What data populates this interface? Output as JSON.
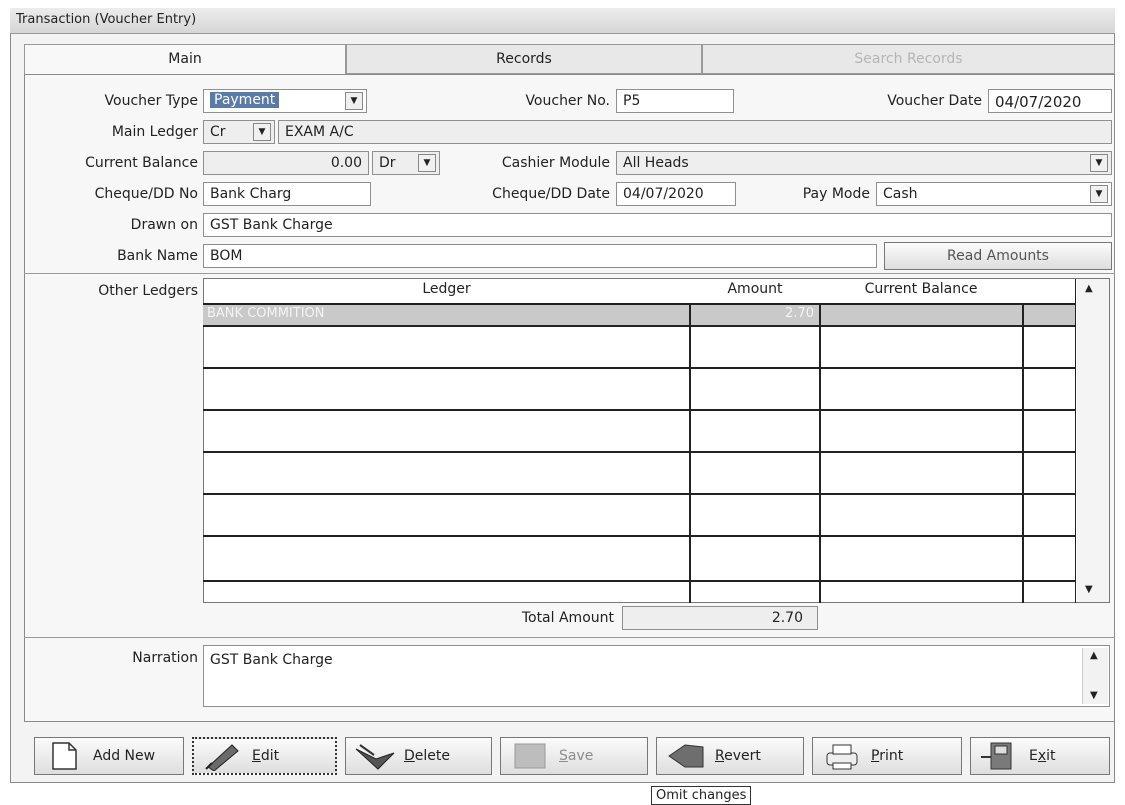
{
  "window": {
    "title": "Transaction (Voucher Entry)"
  },
  "tabs": [
    {
      "label": "Main"
    },
    {
      "label": "Records"
    },
    {
      "label": "Search Records"
    }
  ],
  "form": {
    "voucher_type_label": "Voucher Type",
    "voucher_type_value": "Payment",
    "voucher_no_label": "Voucher No.",
    "voucher_no_value": "P5",
    "voucher_date_label": "Voucher Date",
    "voucher_date_value": "04/07/2020",
    "main_ledger_label": "Main Ledger",
    "main_ledger_crdr": "Cr",
    "main_ledger_value": "EXAM A/C",
    "current_balance_label": "Current Balance",
    "current_balance_value": "0.00",
    "current_balance_drcr": "Dr",
    "cashier_module_label": "Cashier Module",
    "cashier_module_value": "All Heads",
    "cheque_no_label": "Cheque/DD No",
    "cheque_no_value": "Bank Charg",
    "cheque_date_label": "Cheque/DD Date",
    "cheque_date_value": "04/07/2020",
    "pay_mode_label": "Pay Mode",
    "pay_mode_value": "Cash",
    "drawn_on_label": "Drawn on",
    "drawn_on_value": "GST Bank Charge",
    "bank_name_label": "Bank Name",
    "bank_name_value": "BOM",
    "read_amounts_label": "Read Amounts"
  },
  "other_ledgers": {
    "label": "Other Ledgers",
    "columns": [
      "Ledger",
      "Amount",
      "Current Balance"
    ],
    "rows": [
      {
        "ledger": "BANK COMMITION",
        "amount": "2.70",
        "balance": ""
      }
    ],
    "total_label": "Total Amount",
    "total_value": "2.70"
  },
  "narration": {
    "label": "Narration",
    "value": "GST Bank Charge"
  },
  "buttons": {
    "add_new": "Add New",
    "edit": "Edit",
    "delete": "Delete",
    "save": "Save",
    "revert": "Revert",
    "print": "Print",
    "exit": "Exit"
  },
  "tooltip": "Omit changes",
  "colors": {
    "selection": "#5a7aa8",
    "panel": "#f7f7f7",
    "field": "#ffffff"
  }
}
